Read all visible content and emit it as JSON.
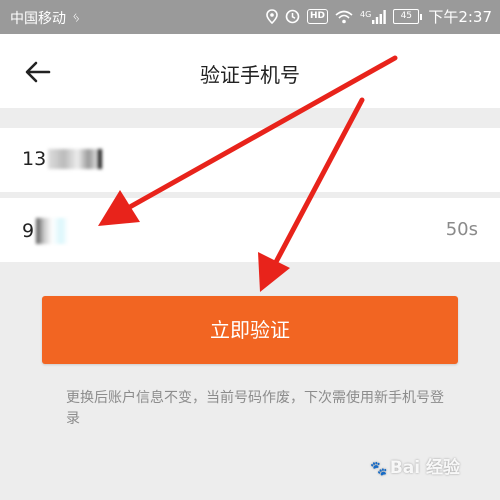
{
  "status_bar": {
    "carrier": "中国移动",
    "carrier_icon": "ᛃ",
    "battery": "45",
    "time": "下午2:37",
    "icons": [
      "location-icon",
      "alarm-icon",
      "hd-icon",
      "wifi-icon",
      "signal-icon",
      "battery-icon"
    ],
    "hd_label": "HD",
    "net_label": "4G"
  },
  "header": {
    "title": "验证手机号",
    "back_icon": "back-arrow-icon"
  },
  "form": {
    "phone_prefix": "13",
    "code_prefix": "9",
    "countdown": "50s"
  },
  "verify_button": {
    "label": "立即验证",
    "color": "#f26522"
  },
  "notice": "更换后账户信息不变，当前号码作废，下次需使用新手机号登录",
  "watermark": {
    "text": "Bai 经验"
  },
  "colors": {
    "status_bar": "#9a9a9a",
    "background": "#ededed",
    "arrow": "#e8231b"
  }
}
